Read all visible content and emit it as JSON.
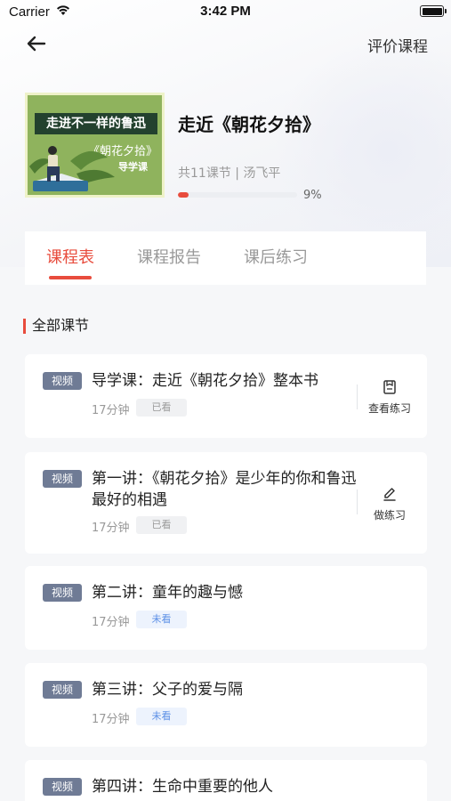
{
  "status_bar": {
    "carrier": "Carrier",
    "time": "3:42 PM"
  },
  "nav": {
    "back_icon": "arrow-left-icon",
    "rate_label": "评价课程"
  },
  "course": {
    "cover": {
      "banner": "走进不一样的鲁迅",
      "subtitle": "《朝花夕拾》",
      "tag": "导学课"
    },
    "title": "走近《朝花夕拾》",
    "meta": "共11课节 | 汤飞平",
    "progress": 0.09,
    "progress_label": "9%"
  },
  "tabs": [
    {
      "label": "课程表",
      "active": true
    },
    {
      "label": "课程报告",
      "active": false
    },
    {
      "label": "课后练习",
      "active": false
    }
  ],
  "section_title": "全部课节",
  "lessons": [
    {
      "tag": "视频",
      "title": "导学课：走近《朝花夕拾》整本书",
      "duration": "17分钟",
      "status": "已看",
      "seen": true,
      "action": {
        "label": "查看练习",
        "icon": "exercise-icon"
      }
    },
    {
      "tag": "视频",
      "title": "第一讲：《朝花夕拾》是少年的你和鲁迅最好的相遇",
      "duration": "17分钟",
      "status": "已看",
      "seen": true,
      "action": {
        "label": "做练习",
        "icon": "edit-icon"
      }
    },
    {
      "tag": "视频",
      "title": "第二讲：童年的趣与憾",
      "duration": "17分钟",
      "status": "未看",
      "seen": false
    },
    {
      "tag": "视频",
      "title": "第三讲：父子的爱与隔",
      "duration": "17分钟",
      "status": "未看",
      "seen": false
    },
    {
      "tag": "视频",
      "title": "第四讲：生命中重要的他人",
      "duration": "",
      "status": "",
      "seen": false
    }
  ],
  "colors": {
    "accent": "#e84c3d",
    "tag_bg": "#6f7b95",
    "unseen_text": "#5b8fe6"
  }
}
